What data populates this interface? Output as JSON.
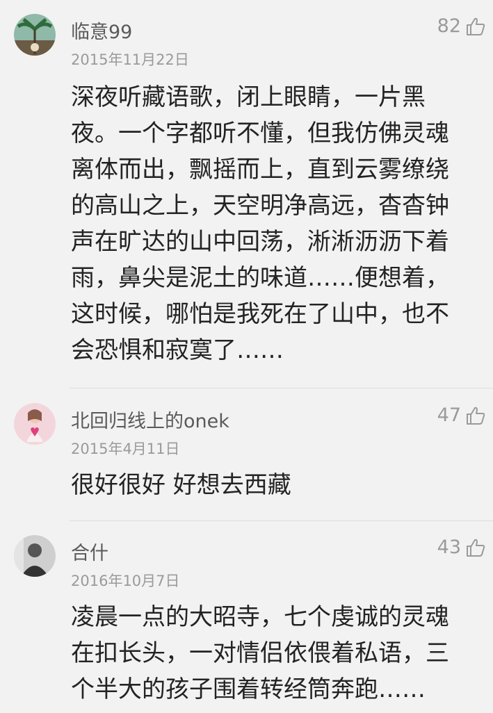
{
  "comments": [
    {
      "username": "临意99",
      "date": "2015年11月22日",
      "likes": "82",
      "avatar_icon": "palm-tree-avatar-icon",
      "text": "深夜听藏语歌，闭上眼睛，一片黑\n夜。一个字都听不懂，但我仿佛灵魂\n离体而出，飘摇而上，直到云雾缭绕\n的高山之上，天空明净高远，杳杳钟\n声在旷达的山中回荡，淅淅沥沥下着\n雨，鼻尖是泥土的味道……便想着，\n这时候，哪怕是我死在了山中，也不\n会恐惧和寂寞了……"
    },
    {
      "username": "北回归线上的onek",
      "date": "2015年4月11日",
      "likes": "47",
      "avatar_icon": "girl-heart-avatar-icon",
      "text": "很好很好  好想去西藏"
    },
    {
      "username": "合什",
      "date": "2016年10月7日",
      "likes": "43",
      "avatar_icon": "man-portrait-avatar-icon",
      "text": "凌晨一点的大昭寺，七个虔诚的灵魂\n在扣长头，一对情侣依偎着私语，三\n个半大的孩子围着转经筒奔跑……"
    }
  ],
  "like_icon": "thumbs-up-icon",
  "colors": {
    "background": "#f2f2f2",
    "username": "#5a5a5a",
    "meta": "#9a9a9a",
    "text": "#232323",
    "divider": "#dcdcdc"
  }
}
